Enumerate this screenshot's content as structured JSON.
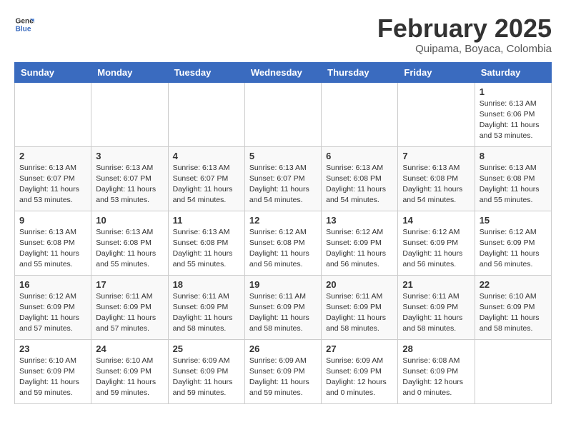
{
  "header": {
    "logo_general": "General",
    "logo_blue": "Blue",
    "title": "February 2025",
    "subtitle": "Quipama, Boyaca, Colombia"
  },
  "weekdays": [
    "Sunday",
    "Monday",
    "Tuesday",
    "Wednesday",
    "Thursday",
    "Friday",
    "Saturday"
  ],
  "weeks": [
    [
      {
        "day": "",
        "info": ""
      },
      {
        "day": "",
        "info": ""
      },
      {
        "day": "",
        "info": ""
      },
      {
        "day": "",
        "info": ""
      },
      {
        "day": "",
        "info": ""
      },
      {
        "day": "",
        "info": ""
      },
      {
        "day": "1",
        "info": "Sunrise: 6:13 AM\nSunset: 6:06 PM\nDaylight: 11 hours and 53 minutes."
      }
    ],
    [
      {
        "day": "2",
        "info": "Sunrise: 6:13 AM\nSunset: 6:07 PM\nDaylight: 11 hours and 53 minutes."
      },
      {
        "day": "3",
        "info": "Sunrise: 6:13 AM\nSunset: 6:07 PM\nDaylight: 11 hours and 53 minutes."
      },
      {
        "day": "4",
        "info": "Sunrise: 6:13 AM\nSunset: 6:07 PM\nDaylight: 11 hours and 54 minutes."
      },
      {
        "day": "5",
        "info": "Sunrise: 6:13 AM\nSunset: 6:07 PM\nDaylight: 11 hours and 54 minutes."
      },
      {
        "day": "6",
        "info": "Sunrise: 6:13 AM\nSunset: 6:08 PM\nDaylight: 11 hours and 54 minutes."
      },
      {
        "day": "7",
        "info": "Sunrise: 6:13 AM\nSunset: 6:08 PM\nDaylight: 11 hours and 54 minutes."
      },
      {
        "day": "8",
        "info": "Sunrise: 6:13 AM\nSunset: 6:08 PM\nDaylight: 11 hours and 55 minutes."
      }
    ],
    [
      {
        "day": "9",
        "info": "Sunrise: 6:13 AM\nSunset: 6:08 PM\nDaylight: 11 hours and 55 minutes."
      },
      {
        "day": "10",
        "info": "Sunrise: 6:13 AM\nSunset: 6:08 PM\nDaylight: 11 hours and 55 minutes."
      },
      {
        "day": "11",
        "info": "Sunrise: 6:13 AM\nSunset: 6:08 PM\nDaylight: 11 hours and 55 minutes."
      },
      {
        "day": "12",
        "info": "Sunrise: 6:12 AM\nSunset: 6:08 PM\nDaylight: 11 hours and 56 minutes."
      },
      {
        "day": "13",
        "info": "Sunrise: 6:12 AM\nSunset: 6:09 PM\nDaylight: 11 hours and 56 minutes."
      },
      {
        "day": "14",
        "info": "Sunrise: 6:12 AM\nSunset: 6:09 PM\nDaylight: 11 hours and 56 minutes."
      },
      {
        "day": "15",
        "info": "Sunrise: 6:12 AM\nSunset: 6:09 PM\nDaylight: 11 hours and 56 minutes."
      }
    ],
    [
      {
        "day": "16",
        "info": "Sunrise: 6:12 AM\nSunset: 6:09 PM\nDaylight: 11 hours and 57 minutes."
      },
      {
        "day": "17",
        "info": "Sunrise: 6:11 AM\nSunset: 6:09 PM\nDaylight: 11 hours and 57 minutes."
      },
      {
        "day": "18",
        "info": "Sunrise: 6:11 AM\nSunset: 6:09 PM\nDaylight: 11 hours and 58 minutes."
      },
      {
        "day": "19",
        "info": "Sunrise: 6:11 AM\nSunset: 6:09 PM\nDaylight: 11 hours and 58 minutes."
      },
      {
        "day": "20",
        "info": "Sunrise: 6:11 AM\nSunset: 6:09 PM\nDaylight: 11 hours and 58 minutes."
      },
      {
        "day": "21",
        "info": "Sunrise: 6:11 AM\nSunset: 6:09 PM\nDaylight: 11 hours and 58 minutes."
      },
      {
        "day": "22",
        "info": "Sunrise: 6:10 AM\nSunset: 6:09 PM\nDaylight: 11 hours and 58 minutes."
      }
    ],
    [
      {
        "day": "23",
        "info": "Sunrise: 6:10 AM\nSunset: 6:09 PM\nDaylight: 11 hours and 59 minutes."
      },
      {
        "day": "24",
        "info": "Sunrise: 6:10 AM\nSunset: 6:09 PM\nDaylight: 11 hours and 59 minutes."
      },
      {
        "day": "25",
        "info": "Sunrise: 6:09 AM\nSunset: 6:09 PM\nDaylight: 11 hours and 59 minutes."
      },
      {
        "day": "26",
        "info": "Sunrise: 6:09 AM\nSunset: 6:09 PM\nDaylight: 11 hours and 59 minutes."
      },
      {
        "day": "27",
        "info": "Sunrise: 6:09 AM\nSunset: 6:09 PM\nDaylight: 12 hours and 0 minutes."
      },
      {
        "day": "28",
        "info": "Sunrise: 6:08 AM\nSunset: 6:09 PM\nDaylight: 12 hours and 0 minutes."
      },
      {
        "day": "",
        "info": ""
      }
    ]
  ]
}
